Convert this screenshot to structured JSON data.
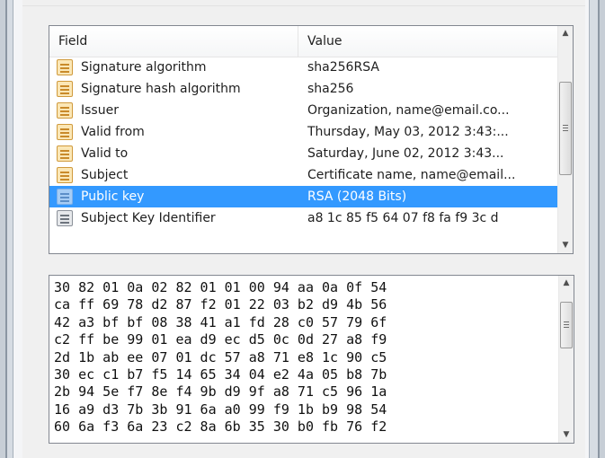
{
  "field_list": {
    "columns": {
      "field": "Field",
      "value": "Value"
    },
    "rows": [
      {
        "field": "Signature algorithm",
        "value": "sha256RSA",
        "selected": false
      },
      {
        "field": "Signature hash algorithm",
        "value": "sha256",
        "selected": false
      },
      {
        "field": "Issuer",
        "value": "Organization, name@email.co...",
        "selected": false
      },
      {
        "field": "Valid from",
        "value": "Thursday, May 03, 2012 3:43:...",
        "selected": false
      },
      {
        "field": "Valid to",
        "value": "Saturday, June 02, 2012 3:43...",
        "selected": false
      },
      {
        "field": "Subject",
        "value": "Certificate name, name@email...",
        "selected": false
      },
      {
        "field": "Public key",
        "value": "RSA (2048 Bits)",
        "selected": true
      },
      {
        "field": "Subject Key Identifier",
        "value": "a8 1c 85 f5 64 07 f8 fa f9 3c d",
        "selected": false
      }
    ],
    "icon": "certificate-field-icon"
  },
  "hex_dump": {
    "lines": [
      "30 82 01 0a 02 82 01 01 00 94 aa 0a 0f 54",
      "ca ff 69 78 d2 87 f2 01 22 03 b2 d9 4b 56",
      "42 a3 bf bf 08 38 41 a1 fd 28 c0 57 79 6f",
      "c2 ff be 99 01 ea d9 ec d5 0c 0d 27 a8 f9",
      "2d 1b ab ee 07 01 dc 57 a8 71 e8 1c 90 c5",
      "30 ec c1 b7 f5 14 65 34 04 e2 4a 05 b8 7b",
      "2b 94 5e f7 8e f4 9b d9 9f a8 71 c5 96 1a",
      "16 a9 d3 7b 3b 91 6a a0 99 f9 1b b9 98 54",
      "60 6a f3 6a 23 c2 8a 6b 35 30 b0 fb 76 f2"
    ]
  },
  "colors": {
    "selection": "#3399ff",
    "border": "#828790",
    "panel": "#f0f0f0"
  }
}
